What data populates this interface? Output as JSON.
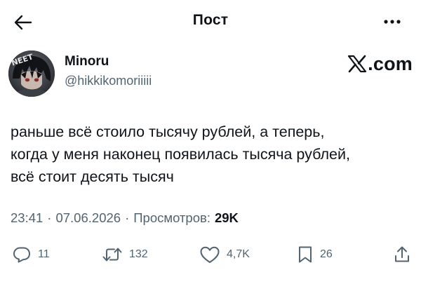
{
  "header": {
    "title": "Пост",
    "back_icon": "arrow-left-icon",
    "more_icon": "more-horizontal-icon"
  },
  "author": {
    "avatar_icon": "avatar-anime-character",
    "avatar_text": "NEET",
    "display_name": "Minoru",
    "handle": "@hikkikomoriiiii"
  },
  "brand": {
    "logo_icon": "x-logo-icon",
    "text": ".com"
  },
  "post": {
    "lines": [
      "раньше всё стоило тысячу рублей, а теперь,",
      "когда у меня наконец появилась тысяча рублей,",
      "всё стоит десять тысяч"
    ]
  },
  "meta": {
    "time": "23:41",
    "date": "07.06.2026",
    "dot": "·",
    "views_label": "Просмотров:",
    "views_count": "29K"
  },
  "actions": {
    "reply": {
      "icon": "reply-icon",
      "count": "11"
    },
    "repost": {
      "icon": "repost-icon",
      "count": "132"
    },
    "like": {
      "icon": "heart-icon",
      "count": "4,7K"
    },
    "bookmark": {
      "icon": "bookmark-icon",
      "count": "26"
    },
    "share": {
      "icon": "share-icon"
    }
  },
  "colors": {
    "text": "#0f1419",
    "secondary": "#536471",
    "background": "#ffffff"
  }
}
